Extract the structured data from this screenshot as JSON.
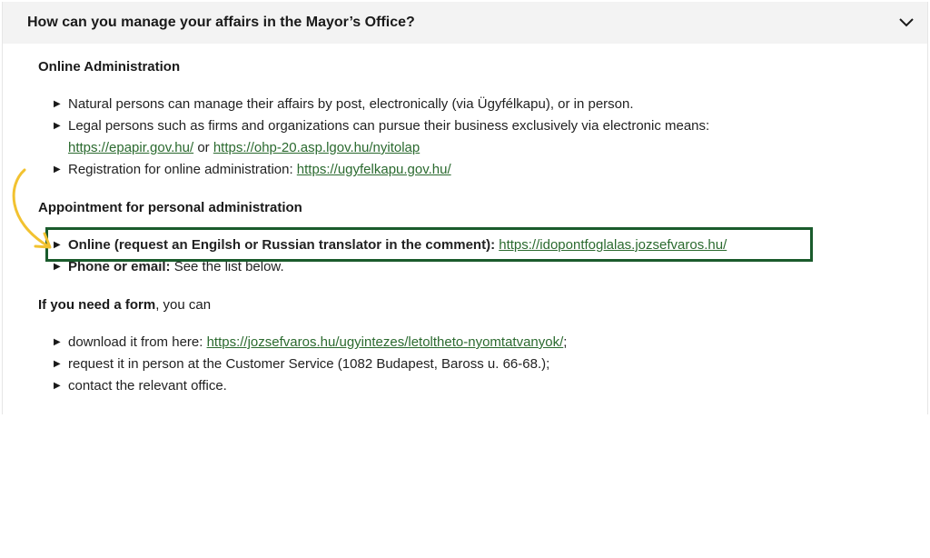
{
  "header": {
    "title": "How can you manage your affairs in the Mayor’s Office?"
  },
  "online_admin": {
    "heading": "Online Administration",
    "items": [
      {
        "text": "Natural persons can manage their affairs by post, electronically (via Ügyfélkapu), or in person."
      },
      {
        "text": "Legal persons such as firms and organizations can pursue their business exclusively via electronic means:",
        "link1": "https://epapir.gov.hu/",
        "sep": " or ",
        "link2": "https://ohp-20.asp.lgov.hu/nyitolap"
      },
      {
        "text": "Registration for online administration: ",
        "link": "https://ugyfelkapu.gov.hu/"
      }
    ]
  },
  "appointment": {
    "heading": "Appointment for personal administration",
    "items": [
      {
        "bold": "Online (request an Engilsh or Russian translator in the comment):",
        "link": "https://idopontfoglalas.jozsefvaros.hu/"
      },
      {
        "bold": "Phone or email:",
        "text": " See the list below."
      }
    ]
  },
  "form": {
    "lead_bold": "If you need a form",
    "lead_rest": ", you can",
    "items": [
      {
        "text": "download it from here: ",
        "link": "https://jozsefvaros.hu/ugyintezes/letoltheto-nyomtatvanyok/",
        "suffix": ";"
      },
      {
        "text": "request it in person at the Customer Service (1082 Budapest, Baross u. 66-68.);"
      },
      {
        "text": "contact the relevant office."
      }
    ]
  },
  "icons": {
    "expand": "chevron-down-icon",
    "annotation": "curved-arrow-icon"
  },
  "colors": {
    "link": "#2b6a2f",
    "highlight_border": "#1a5b2c",
    "arrow": "#f2c230",
    "header_bg": "#f3f3f3"
  }
}
